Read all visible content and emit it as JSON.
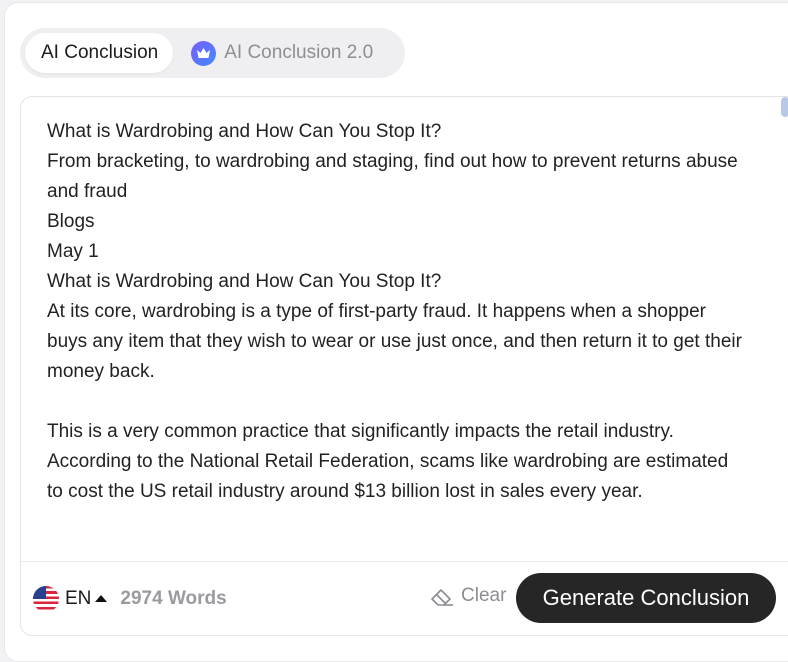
{
  "tabs": [
    {
      "label": "AI Conclusion",
      "active": true
    },
    {
      "label": "AI Conclusion 2.0",
      "active": false,
      "icon": "crown-icon"
    }
  ],
  "editor": {
    "lines": [
      "What is Wardrobing and How Can You Stop It?",
      "From bracketing, to wardrobing and staging, find out how to prevent returns abuse and fraud",
      "Blogs",
      "May 1",
      "What is Wardrobing and How Can You Stop It?",
      "At its core, wardrobing is a type of first-party fraud. It happens when a shopper buys any item that they wish to wear or use just once, and then return it to get their money back.",
      "",
      "This is a very common practice that significantly impacts the retail industry. According to the National Retail Federation, scams like wardrobing are estimated to cost the US retail industry around $13 billion lost in sales every year."
    ]
  },
  "footer": {
    "language_code": "EN",
    "flag_icon": "us-flag-icon",
    "word_count": "2974 Words",
    "clear_label": "Clear",
    "generate_label": "Generate Conclusion"
  },
  "colors": {
    "primary_button": "#262626",
    "crown_gradient_start": "#7b5cff",
    "crown_gradient_end": "#3f8bff",
    "scroll_thumb": "#b9c8e6"
  }
}
